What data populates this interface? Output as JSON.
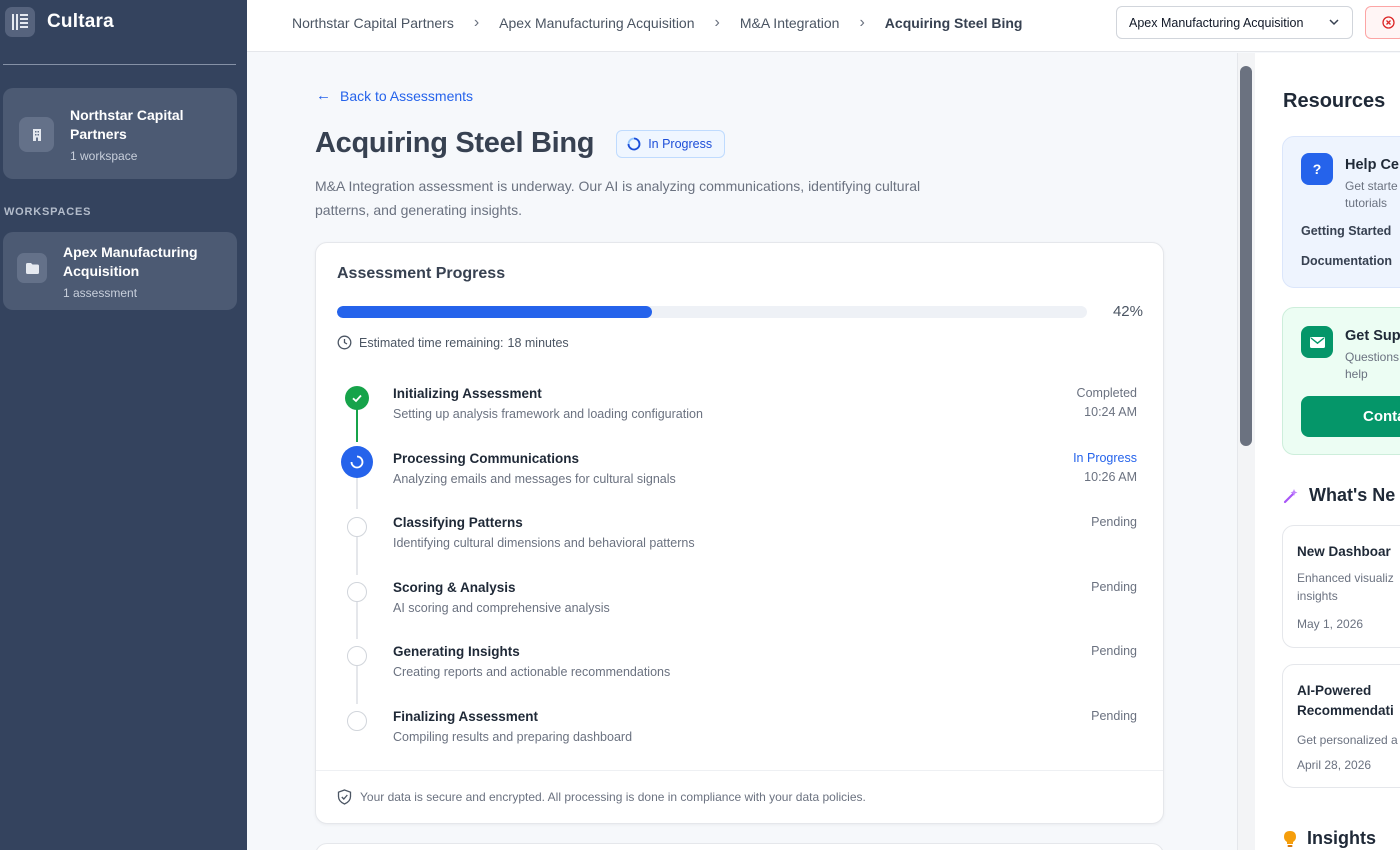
{
  "sidebar": {
    "brand": "Cultara",
    "org": {
      "name": "Northstar Capital Partners",
      "sub": "1 workspace"
    },
    "section_label": "WORKSPACES",
    "workspace": {
      "name": "Apex Manufacturing Acquisition",
      "sub": "1 assessment"
    }
  },
  "topbar": {
    "breadcrumbs": [
      "Northstar Capital Partners",
      "Apex Manufacturing Acquisition",
      "M&A Integration",
      "Acquiring Steel Bing"
    ],
    "workspace_select": "Apex Manufacturing Acquisition"
  },
  "main": {
    "back_label": "Back to Assessments",
    "title": "Acquiring Steel Bing",
    "status_badge": "In Progress",
    "description": "M&A Integration assessment is underway. Our AI is analyzing communications, identifying cultural patterns, and generating insights.",
    "progress": {
      "title": "Assessment Progress",
      "percent": 42,
      "percent_label": "42%",
      "eta_label": "Estimated time remaining:",
      "eta_value": "18 minutes",
      "steps": [
        {
          "name": "Initializing Assessment",
          "desc": "Setting up analysis framework and loading configuration",
          "status": "Completed",
          "time": "10:24 AM",
          "state": "done"
        },
        {
          "name": "Processing Communications",
          "desc": "Analyzing emails and messages for cultural signals",
          "status": "In Progress",
          "time": "10:26 AM",
          "state": "active"
        },
        {
          "name": "Classifying Patterns",
          "desc": "Identifying cultural dimensions and behavioral patterns",
          "status": "Pending",
          "time": "",
          "state": "pending"
        },
        {
          "name": "Scoring & Analysis",
          "desc": "AI scoring and comprehensive analysis",
          "status": "Pending",
          "time": "",
          "state": "pending"
        },
        {
          "name": "Generating Insights",
          "desc": "Creating reports and actionable recommendations",
          "status": "Pending",
          "time": "",
          "state": "pending"
        },
        {
          "name": "Finalizing Assessment",
          "desc": "Compiling results and preparing dashboard",
          "status": "Pending",
          "time": "",
          "state": "pending"
        }
      ],
      "footer": "Your data is secure and encrypted. All processing is done in compliance with your data policies."
    }
  },
  "right": {
    "resources_title": "Resources",
    "help": {
      "title": "Help Ce",
      "sub": "Get starte tutorials",
      "link1": "Getting Started",
      "link2": "Documentation"
    },
    "support": {
      "title": "Get Sup",
      "sub": "Questions help",
      "button": "Conta"
    },
    "whats_new_title": "What's Ne",
    "news": [
      {
        "title": "New Dashboar",
        "sub": "Enhanced visualiz insights",
        "date": "May 1, 2026"
      },
      {
        "title": "AI-Powered Recommendati",
        "sub": "Get personalized a",
        "date": "April 28, 2026"
      }
    ],
    "insights_title": "Insights"
  },
  "colors": {
    "sidebar": "#34435e",
    "accent": "#2563eb",
    "success": "#16a34a",
    "support": "#059669"
  }
}
